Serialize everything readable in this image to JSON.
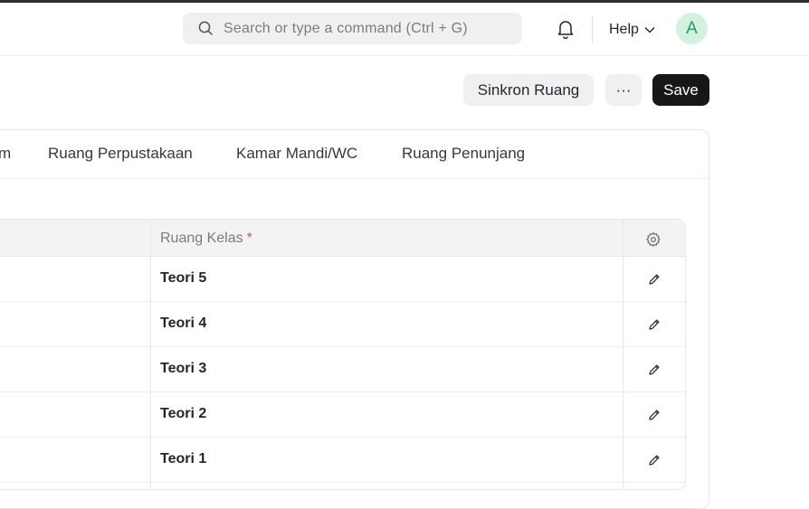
{
  "navbar": {
    "search_placeholder": "Search or type a command (Ctrl + G)",
    "help_label": "Help",
    "avatar_initial": "A"
  },
  "actions": {
    "sync_label": "Sinkron Ruang",
    "more_label": "···",
    "save_label": "Save"
  },
  "tabs": [
    {
      "label": "m"
    },
    {
      "label": "Ruang Perpustakaan"
    },
    {
      "label": "Kamar Mandi/WC"
    },
    {
      "label": "Ruang Penunjang"
    }
  ],
  "grid": {
    "column_header": "Ruang Kelas",
    "required_mark": "*",
    "rows": [
      {
        "ruang_kelas": "Teori 5"
      },
      {
        "ruang_kelas": "Teori 4"
      },
      {
        "ruang_kelas": "Teori 3"
      },
      {
        "ruang_kelas": "Teori 2"
      },
      {
        "ruang_kelas": "Teori 1"
      }
    ]
  },
  "colors": {
    "primary_button": "#171717",
    "avatar_bg": "#d2f1e1",
    "avatar_fg": "#2f9b63",
    "required": "#e24c4c"
  }
}
